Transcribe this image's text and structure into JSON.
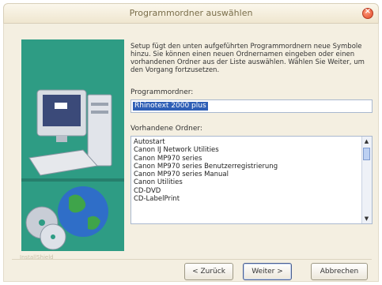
{
  "window": {
    "title": "Programmordner auswählen"
  },
  "instructions": "Setup fügt den unten aufgeführten Programmordnern neue Symbole hinzu. Sie können einen neuen Ordnernamen eingeben oder einen vorhandenen Ordner aus der Liste auswählen. Wählen Sie Weiter, um den Vorgang fortzusetzen.",
  "program_folder": {
    "label": "Programmordner:",
    "value": "Rhinotext 2000 plus"
  },
  "existing_folders": {
    "label": "Vorhandene Ordner:",
    "items": [
      "Autostart",
      "Canon IJ Network Utilities",
      "Canon MP970 series",
      "Canon MP970 series Benutzerregistrierung",
      "Canon MP970 series Manual",
      "Canon Utilities",
      "CD-DVD",
      "CD-LabelPrint"
    ]
  },
  "brand": "InstallShield",
  "buttons": {
    "back": "< Zurück",
    "next": "Weiter >",
    "cancel": "Abbrechen"
  },
  "colors": {
    "side_panel": "#2e9c84",
    "selection": "#2f5fb6",
    "close_button": "#e04a2a"
  }
}
